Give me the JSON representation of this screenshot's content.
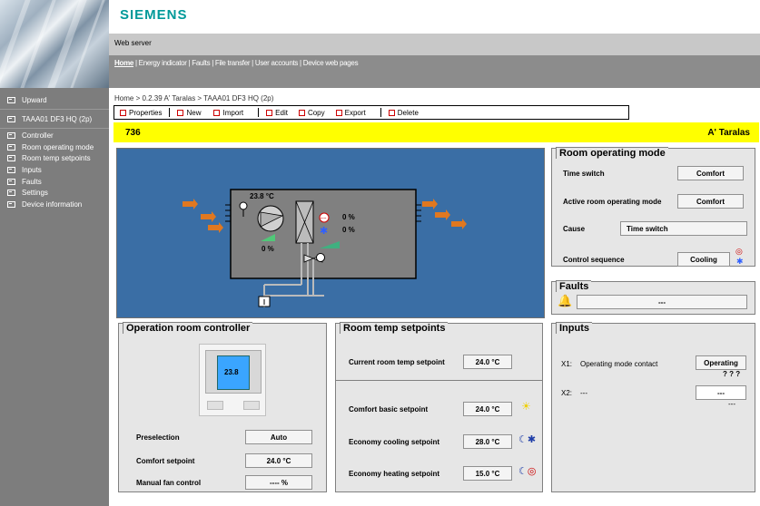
{
  "brand": "SIEMENS",
  "header": {
    "web_server": "Web server"
  },
  "menu": {
    "home": "Home",
    "rest": " | Energy indicator | Faults | File transfer | User accounts | Device web pages"
  },
  "sidebar": {
    "upward": "Upward",
    "device": "TAAA01 DF3 HQ (2p)",
    "items": [
      "Controller",
      "Room operating mode",
      "Room temp setpoints",
      "Inputs",
      "Faults",
      "Settings",
      "Device information"
    ]
  },
  "breadcrumb": "Home > 0.2.39 A' Taralas > TAAA01 DF3 HQ (2p)",
  "toolbar": {
    "properties": "Properties",
    "new": "New",
    "import": "Import",
    "edit": "Edit",
    "copy": "Copy",
    "export": "Export",
    "delete": "Delete"
  },
  "title": {
    "number": "736",
    "name": "A' Taralas"
  },
  "plant": {
    "temp": "23.8 °C",
    "heat_pct": "0 %",
    "cool_pct": "0 %",
    "fan_pct": "0 %"
  },
  "room_mode": {
    "title": "Room operating mode",
    "time_switch_label": "Time switch",
    "time_switch_value": "Comfort",
    "active_label": "Active room operating mode",
    "active_value": "Comfort",
    "cause_label": "Cause",
    "cause_value": "Time switch",
    "sequence_label": "Control sequence",
    "sequence_value": "Cooling"
  },
  "faults": {
    "title": "Faults",
    "value": "---"
  },
  "controller": {
    "title": "Operation room controller",
    "display_temp": "23.8",
    "preselection_label": "Preselection",
    "preselection_value": "Auto",
    "comfort_label": "Comfort setpoint",
    "comfort_value": "24.0 °C",
    "fan_label": "Manual fan control",
    "fan_value": "---- %"
  },
  "setpoints": {
    "title": "Room temp setpoints",
    "current_label": "Current room temp setpoint",
    "current_value": "24.0 °C",
    "comfort_label": "Comfort basic setpoint",
    "comfort_value": "24.0 °C",
    "eco_cool_label": "Economy cooling setpoint",
    "eco_cool_value": "28.0 °C",
    "eco_heat_label": "Economy heating setpoint",
    "eco_heat_value": "15.0 °C"
  },
  "inputs": {
    "title": "Inputs",
    "x1_id": "X1:",
    "x1_label": "Operating mode contact",
    "x1_value": "Operating",
    "x1_sub": "? ? ?",
    "x2_id": "X2:",
    "x2_label": "---",
    "x2_value": "---",
    "x2_sub": "---"
  },
  "colors": {
    "brand": "#009999",
    "title_bar": "#ffff00",
    "plant_bg": "#3a6ea5",
    "nav_bg": "#7d7d7d"
  }
}
